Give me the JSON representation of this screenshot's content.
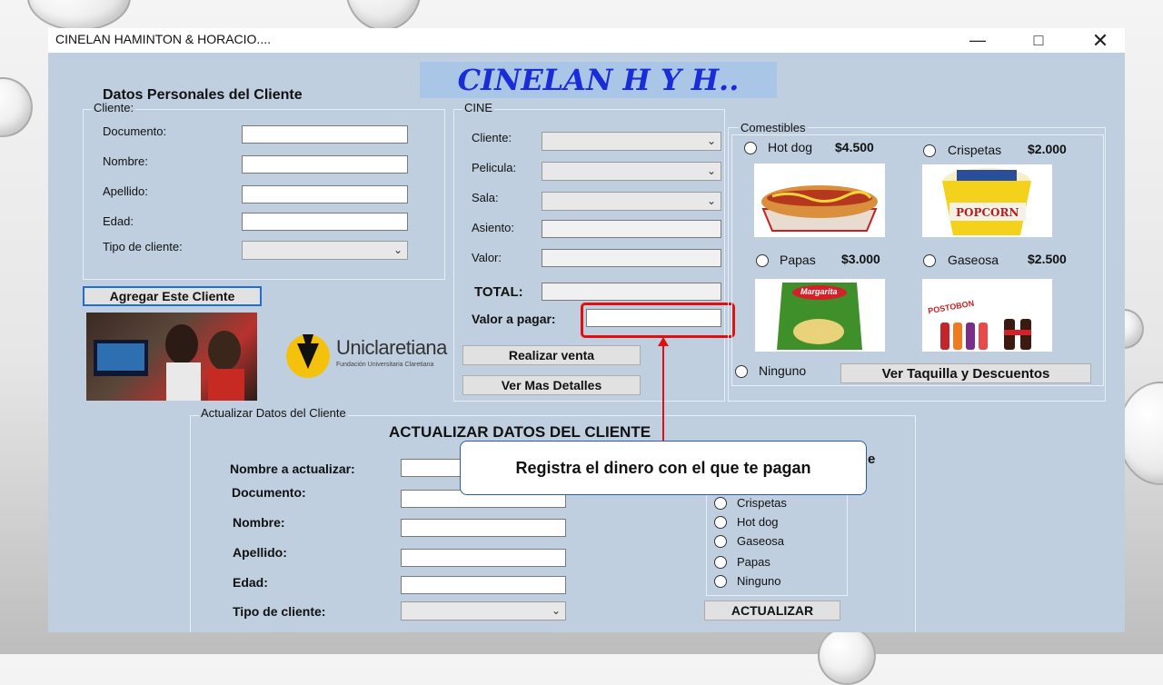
{
  "window": {
    "title": "CINELAN HAMINTON & HORACIO...."
  },
  "banner": "CINELAN H Y H..",
  "personal": {
    "heading": "Datos Personales del Cliente",
    "group_caption": "Cliente:",
    "documento": "Documento:",
    "nombre": "Nombre:",
    "apellido": "Apellido:",
    "edad": "Edad:",
    "tipo": "Tipo de cliente:",
    "add_button": "Agregar Este Cliente"
  },
  "logo": {
    "name": "Uniclaretiana",
    "sub": "Fundación Universitaria Claretiana"
  },
  "cine": {
    "caption": "CINE",
    "cliente": "Cliente:",
    "pelicula": "Pelicula:",
    "sala": "Sala:",
    "asiento": "Asiento:",
    "valor": "Valor:",
    "total": "TOTAL:",
    "valor_pagar": "Valor a pagar:",
    "realizar": "Realizar venta",
    "detalles": "Ver Mas Detalles"
  },
  "comestibles": {
    "caption": "Comestibles",
    "items": [
      {
        "name": "Hot dog",
        "price": "$4.500"
      },
      {
        "name": "Crispetas",
        "price": "$2.000"
      },
      {
        "name": "Papas",
        "price": "$3.000"
      },
      {
        "name": "Gaseosa",
        "price": "$2.500"
      }
    ],
    "ninguno": "Ninguno",
    "taquilla": "Ver Taquilla  y Descuentos",
    "popcorn_text": "POPCORN",
    "chips_text": "Margarita",
    "soda_text": "POSTOBON"
  },
  "update": {
    "caption": "Actualizar Datos del Cliente",
    "heading": "ACTUALIZAR DATOS DEL CLIENTE",
    "nombre_act": "Nombre a actualizar:",
    "documento": "Documento:",
    "nombre": "Nombre:",
    "apellido": "Apellido:",
    "edad": "Edad:",
    "tipo": "Tipo de cliente:",
    "partial_label": "e",
    "options": [
      "Crispetas",
      "Hot dog",
      "Gaseosa",
      "Papas",
      "Ninguno"
    ],
    "actualizar": "ACTUALIZAR"
  },
  "callout": "Registra el dinero con el que te pagan",
  "colors": {
    "form_bg": "#bfcfe0",
    "banner_bg": "#a9c6e6",
    "banner_text": "#1a2bd8",
    "highlight": "#e01010"
  }
}
